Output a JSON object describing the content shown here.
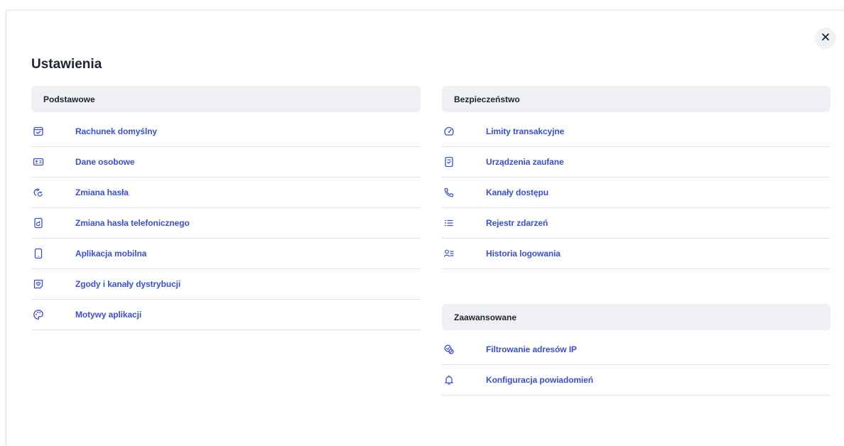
{
  "dialog": {
    "title": "Ustawienia",
    "close_icon": "close-icon"
  },
  "colors": {
    "accent": "#3a4fd6",
    "header_bg": "#eff0f3",
    "divider": "#e1e3e8"
  },
  "sections": {
    "basic": {
      "header": "Podstawowe",
      "items": [
        {
          "label": "Rachunek domyślny",
          "icon": "wallet-check-icon"
        },
        {
          "label": "Dane osobowe",
          "icon": "id-card-icon"
        },
        {
          "label": "Zmiana hasła",
          "icon": "password-change-icon"
        },
        {
          "label": "Zmiana hasła telefonicznego",
          "icon": "phone-password-icon"
        },
        {
          "label": "Aplikacja mobilna",
          "icon": "mobile-phone-icon"
        },
        {
          "label": "Zgody i kanały dystrybucji",
          "icon": "consent-icon"
        },
        {
          "label": "Motywy aplikacji",
          "icon": "palette-icon"
        }
      ]
    },
    "security": {
      "header": "Bezpieczeństwo",
      "items": [
        {
          "label": "Limity transakcyjne",
          "icon": "gauge-icon"
        },
        {
          "label": "Urządzenia zaufane",
          "icon": "trusted-device-icon"
        },
        {
          "label": "Kanały dostępu",
          "icon": "phone-call-icon"
        },
        {
          "label": "Rejestr zdarzeń",
          "icon": "list-icon"
        },
        {
          "label": "Historia logowania",
          "icon": "user-list-icon"
        }
      ]
    },
    "advanced": {
      "header": "Zaawansowane",
      "items": [
        {
          "label": "Filtrowanie adresów IP",
          "icon": "ip-filter-icon"
        },
        {
          "label": "Konfiguracja powiadomień",
          "icon": "bell-icon"
        }
      ]
    }
  }
}
